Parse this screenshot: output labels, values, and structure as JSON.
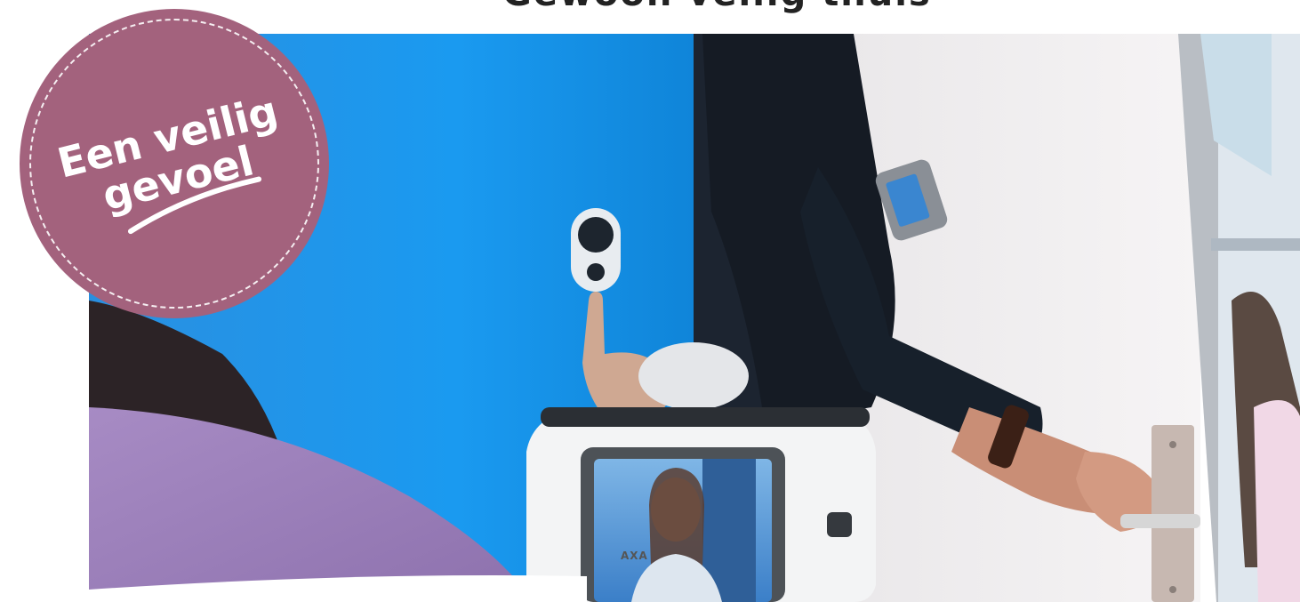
{
  "header": {
    "cut_heading": "Gewoon veilig thuis"
  },
  "badge": {
    "line1": "Een veilig",
    "line2": "gevoel",
    "color": "#a3627d"
  },
  "product": {
    "brand": "AXA"
  },
  "colors": {
    "wall": "#1c96e8",
    "door": "#f0eded",
    "skin": "#d6a893"
  }
}
